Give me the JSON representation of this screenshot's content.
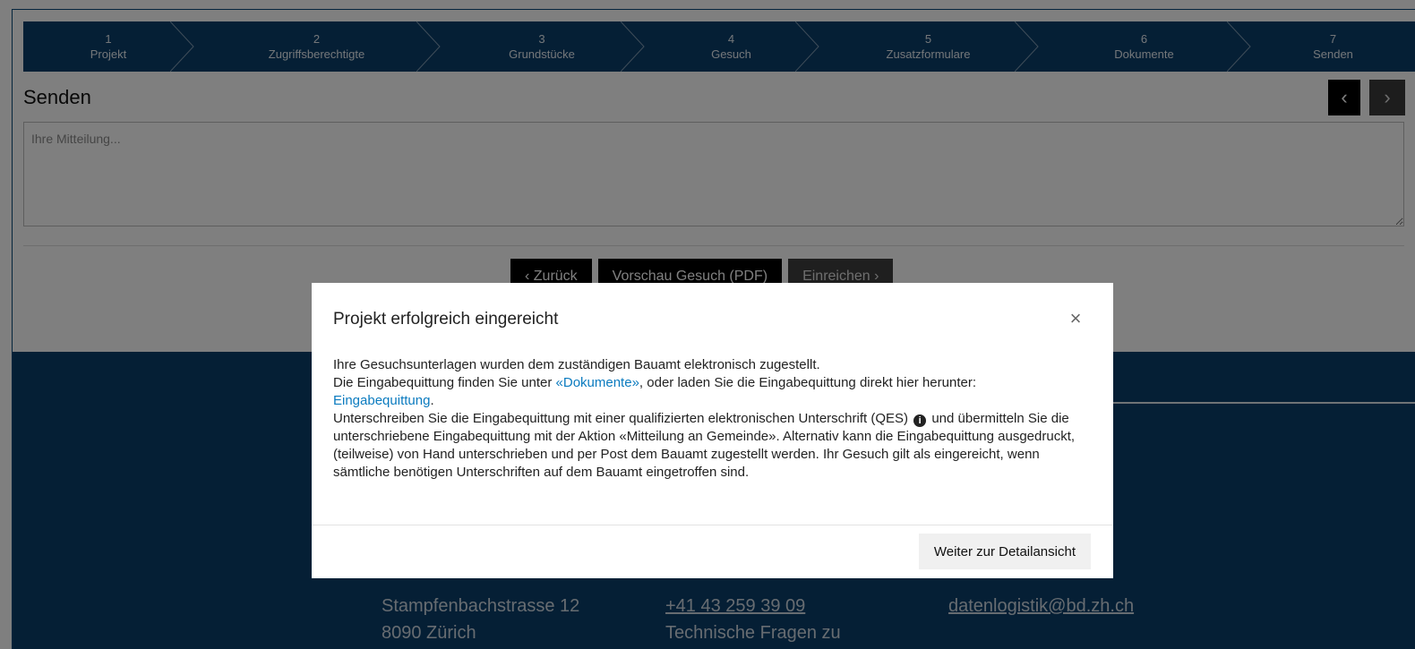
{
  "stepper": {
    "steps": [
      {
        "num": "1",
        "label": "Projekt"
      },
      {
        "num": "2",
        "label": "Zugriffsberechtigte"
      },
      {
        "num": "3",
        "label": "Grundstücke"
      },
      {
        "num": "4",
        "label": "Gesuch"
      },
      {
        "num": "5",
        "label": "Zusatzformulare"
      },
      {
        "num": "6",
        "label": "Dokumente"
      },
      {
        "num": "7",
        "label": "Senden"
      }
    ]
  },
  "page": {
    "title": "Senden",
    "nav_prev": "‹",
    "nav_next": "›",
    "message_placeholder": "Ihre Mitteilung...",
    "buttons": {
      "back": "‹ Zurück",
      "preview": "Vorschau Gesuch (PDF)",
      "submit": "Einreichen ›"
    }
  },
  "footer": {
    "address_line1": "Stampfenbachstrasse 12",
    "address_line2": "8090 Zürich",
    "phone": "+41 43 259 39 09",
    "phone_note": "Technische Fragen zu",
    "email": "datenlogistik@bd.zh.ch"
  },
  "modal": {
    "title": "Projekt erfolgreich eingereicht",
    "close": "×",
    "line1": "Ihre Gesuchsunterlagen wurden dem zuständigen Bauamt elektronisch zugestellt.",
    "line2_pre": "Die Eingabequittung finden Sie unter ",
    "line2_link": "«Dokumente»",
    "line2_post": ", oder laden Sie die Eingabequittung direkt hier herunter:",
    "line3_link": "Eingabequittung",
    "line3_post": ".",
    "para_pre": "Unterschreiben Sie die Eingabequittung mit einer qualifizierten elektronischen Unterschrift (QES)",
    "info_icon": "i",
    "para_post": " und übermitteln Sie die unterschriebene Eingabequittung mit der Aktion «Mitteilung an Gemeinde». Alternativ kann die Eingabequittung ausgedruckt, (teilweise) von Hand unterschrieben und per Post dem Bauamt zugestellt werden. Ihr Gesuch gilt als eingereicht, wenn sämtliche benötigen Unterschriften auf dem Bauamt eingetroffen sind.",
    "primary_button": "Weiter zur Detailansicht"
  }
}
